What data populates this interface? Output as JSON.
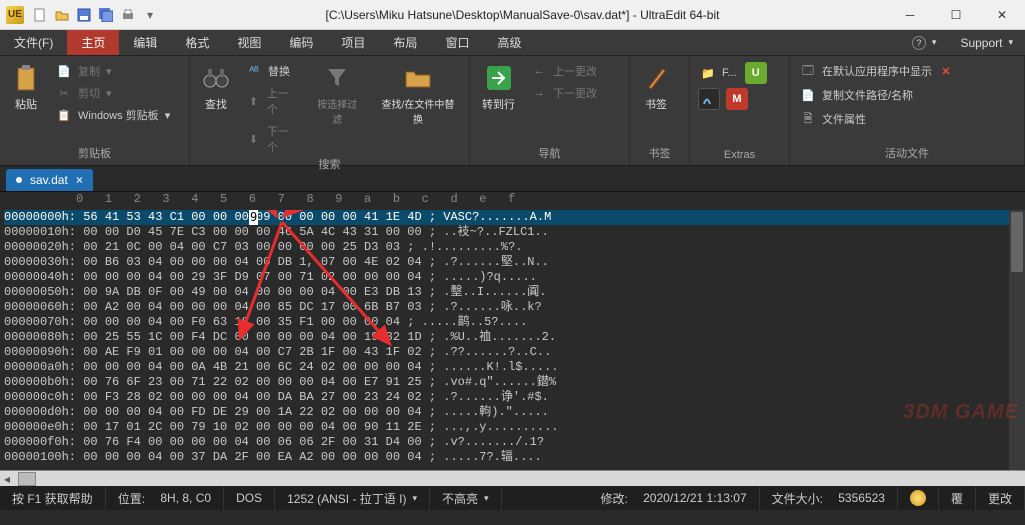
{
  "title": "[C:\\Users\\Miku Hatsune\\Desktop\\ManualSave-0\\sav.dat*] - UltraEdit 64-bit",
  "app_icon": "UE",
  "menu": {
    "items": [
      "文件(F)",
      "主页",
      "编辑",
      "格式",
      "视图",
      "编码",
      "项目",
      "布局",
      "窗口",
      "高级"
    ],
    "active_index": 1,
    "support": "Support"
  },
  "ribbon": {
    "clipboard": {
      "paste": "粘贴",
      "copy": "复制",
      "cut": "剪切",
      "winclip": "Windows 剪贴板",
      "label": "剪贴板"
    },
    "search": {
      "find": "查找",
      "replace": "替换",
      "prev": "上一个",
      "next": "下一个",
      "filter": "按选择过滤",
      "findinfiles": "查找/在文件中替换",
      "label": "搜索"
    },
    "nav": {
      "gotoline": "转到行",
      "prevchange": "上一更改",
      "nextchange": "下一更改",
      "label": "导航"
    },
    "bookmarks": {
      "main": "书签",
      "label": "书签"
    },
    "extras": {
      "f": "F...",
      "label": "Extras"
    },
    "active": {
      "open_default": "在默认应用程序中显示",
      "copy_path": "复制文件路径/名称",
      "props": "文件属性",
      "label": "活动文件"
    }
  },
  "tab": {
    "name": "sav.dat",
    "close": "×"
  },
  "ruler": "          0   1   2   3   4   5   6   7   8   9   a   b   c   d   e   f",
  "hexrows": [
    {
      "a": "00000000h:",
      "h": "56 41 53 43 C1 00 00 00 09 00 00 00 00 41 1E 4D",
      "t": "; VASC?.......A.M"
    },
    {
      "a": "00000010h:",
      "h": "00 00 D0 45 7E C3 00 00 00 46 5A 4C 43 31 00 00",
      "t": "; ..衼~?..FZLC1.."
    },
    {
      "a": "00000020h:",
      "h": "00 21 0C 00 04 00 C7 03 00 00 00 00 25 D3 03",
      "t": "; .!.........%?."
    },
    {
      "a": "00000030h:",
      "h": "00 B6 03 04 00 00 00 04 00 DB 1, 07 00 4E 02 04",
      "t": "; .?......堅..N.."
    },
    {
      "a": "00000040h:",
      "h": "00 00 00 04 00 29 3F D9 07 00 71 02 00 00 00 04",
      "t": "; .....)?q....."
    },
    {
      "a": "00000050h:",
      "h": "00 9A DB 0F 00 49 00 04 00 00 00 04 00 E3 DB 13",
      "t": "; .墼..I......阗."
    },
    {
      "a": "00000060h:",
      "h": "00 A2 00 04 00 00 00 04 00 85 DC 17 00 6B B7 03",
      "t": "; .?......咏..k?"
    },
    {
      "a": "00000070h:",
      "h": "00 00 00 04 00 F0 63 18 00 35 F1 00 00 00 04",
      "t": "; .....鹋..5?...."
    },
    {
      "a": "00000080h:",
      "h": "00 25 55 1C 00 F4 DC 00 00 00 00 04 00 19 32 1D",
      "t": "; .%U..裇.......2."
    },
    {
      "a": "00000090h:",
      "h": "00 AE F9 01 00 00 00 04 00 C7 2B 1F 00 43 1F 02",
      "t": "; .??......?..C.."
    },
    {
      "a": "000000a0h:",
      "h": "00 00 00 04 00 0A 4B 21 00 6C 24 02 00 00 00 04",
      "t": "; ......K!.l$....."
    },
    {
      "a": "000000b0h:",
      "h": "00 76 6F 23 00 71 22 02 00 00 00 04 00 E7 91 25",
      "t": "; .vo#.q\"......鐟%"
    },
    {
      "a": "000000c0h:",
      "h": "00 F3 28 02 00 00 00 04 00 DA BA 27 00 23 24 02",
      "t": "; .?......诤'.#$."
    },
    {
      "a": "000000d0h:",
      "h": "00 00 00 04 00 FD DE 29 00 1A 22 02 00 00 00 04",
      "t": "; .....軥).\"....."
    },
    {
      "a": "000000e0h:",
      "h": "00 17 01 2C 00 79 10 02 00 00 00 04 00 90 11 2E",
      "t": "; ...,.y.........."
    },
    {
      "a": "000000f0h:",
      "h": "00 76 F4 00 00 00 00 04 00 06 06 2F 00 31 D4 00",
      "t": "; .v?......./.1?"
    },
    {
      "a": "00000100h:",
      "h": "00 00 00 04 00 37 DA 2F 00 EA A2 00 00 00 00 04",
      "t": "; .....7?.辐...."
    }
  ],
  "cursor": {
    "row": 0,
    "col": 8,
    "char": "9"
  },
  "watermark": "3DM GAME",
  "status": {
    "help": "按 F1 获取帮助",
    "pos_label": "位置:",
    "pos_value": "8H, 8, C0",
    "dos": "DOS",
    "enc": "1252 (ANSI - 拉丁语 I)",
    "highlight": "不高亮",
    "mod_label": "修改:",
    "mod_value": "2020/12/21 1:13:07",
    "size_label": "文件大小:",
    "size_value": "5356523",
    "ins": "覆",
    "rw": "更改"
  }
}
